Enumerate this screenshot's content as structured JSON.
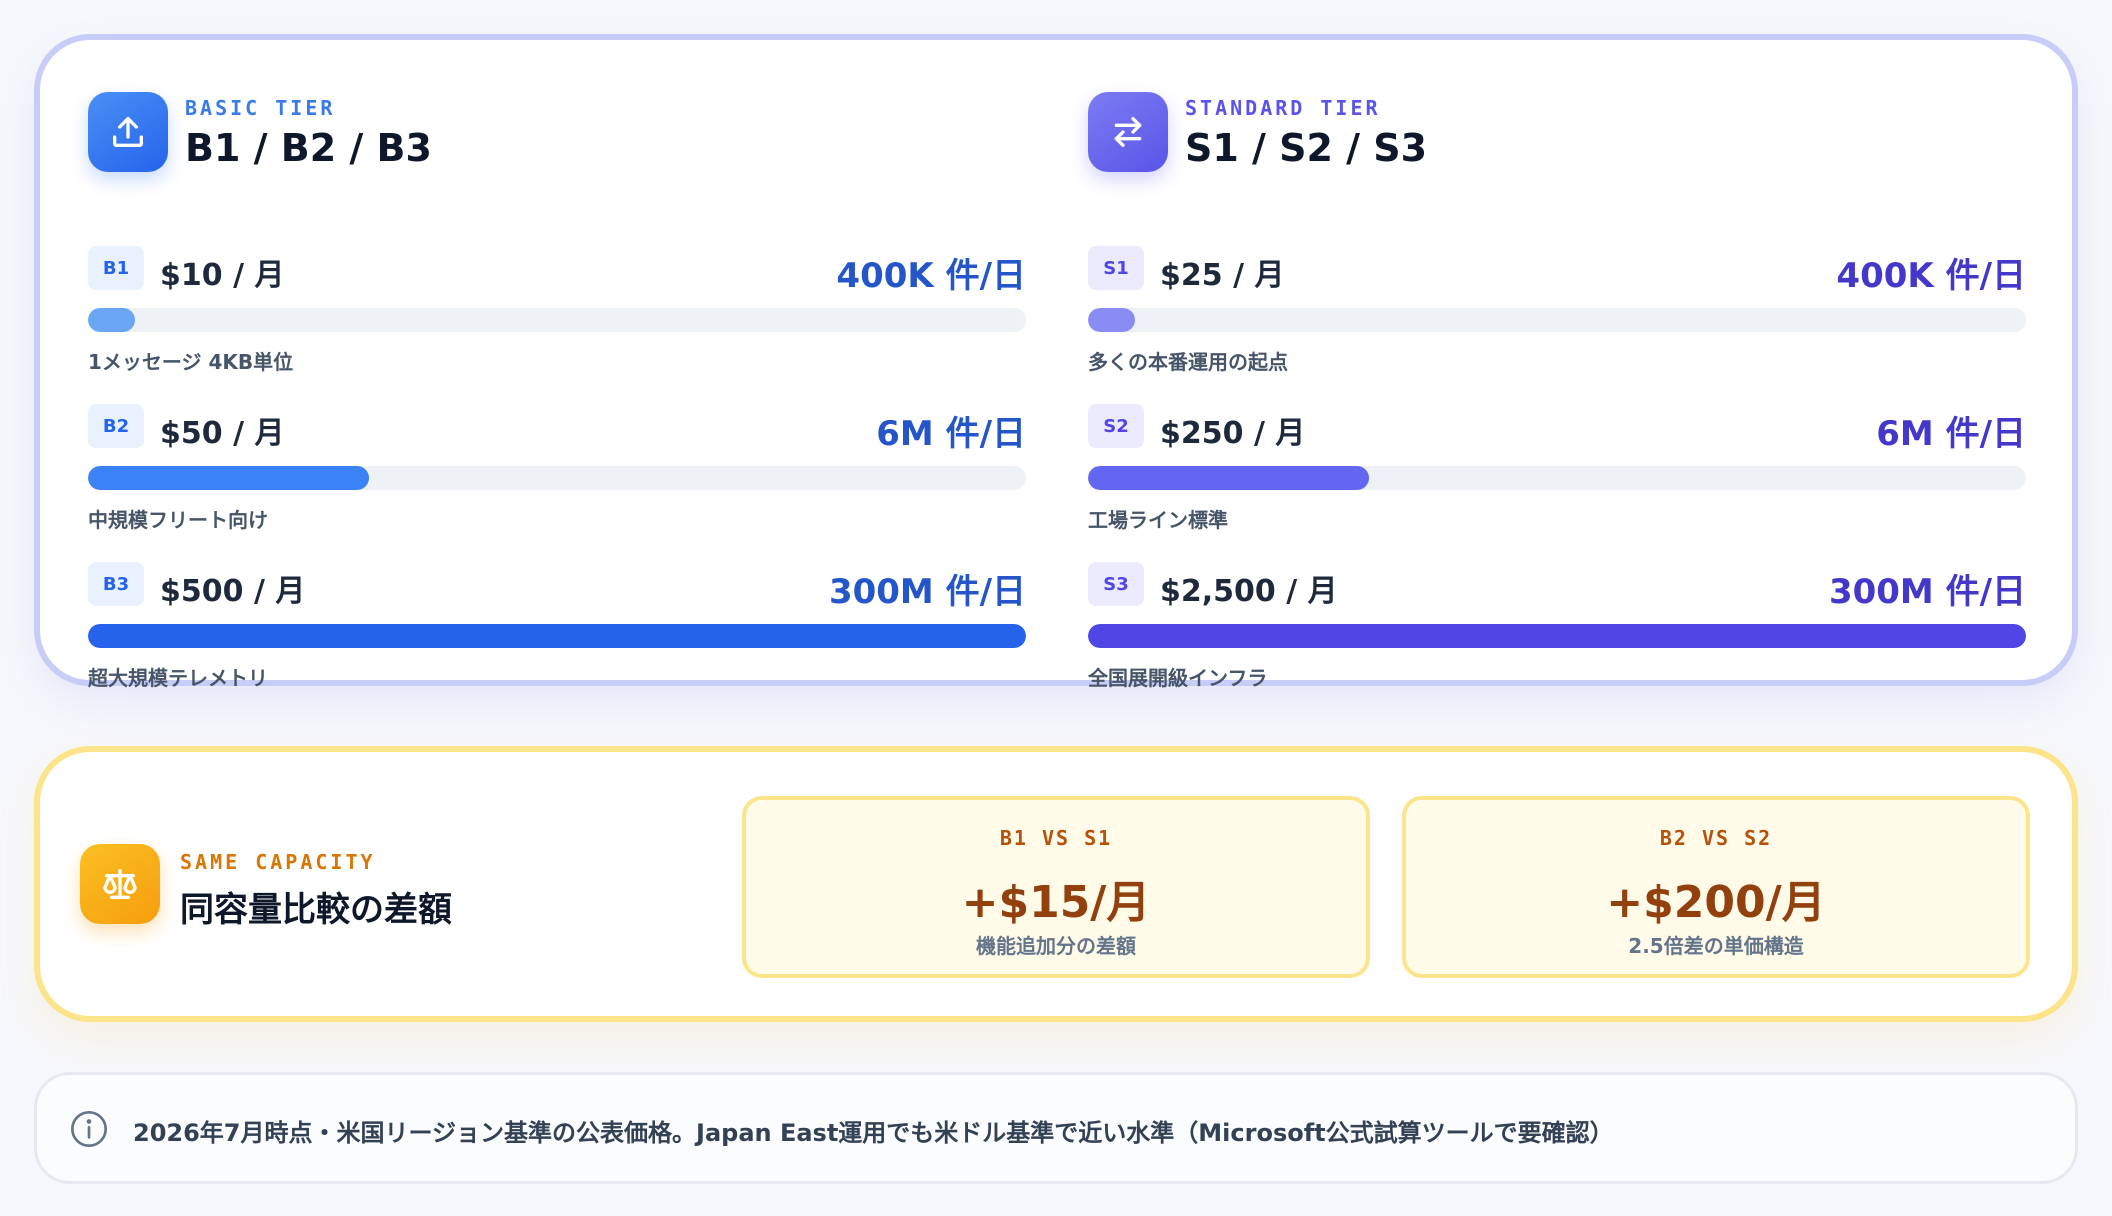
{
  "tiers": [
    {
      "kicker": "BASIC TIER",
      "title": "B1 / B2 / B3",
      "icon": "upload-icon",
      "color": "#2563eb",
      "plans": [
        {
          "code": "B1",
          "price": "$10 / 月",
          "capacity": "400K 件/日",
          "note": "1メッセージ 4KB単位",
          "level": 0.05
        },
        {
          "code": "B2",
          "price": "$50 / 月",
          "capacity": "6M 件/日",
          "note": "中規模フリート向け",
          "level": 0.3
        },
        {
          "code": "B3",
          "price": "$500 / 月",
          "capacity": "300M 件/日",
          "note": "超大規模テレメトリ",
          "level": 1.0
        }
      ]
    },
    {
      "kicker": "STANDARD TIER",
      "title": "S1 / S2 / S3",
      "icon": "swap-arrows-icon",
      "color": "#4f46e5",
      "plans": [
        {
          "code": "S1",
          "price": "$25 / 月",
          "capacity": "400K 件/日",
          "note": "多くの本番運用の起点",
          "level": 0.05
        },
        {
          "code": "S2",
          "price": "$250 / 月",
          "capacity": "6M 件/日",
          "note": "工場ライン標準",
          "level": 0.3
        },
        {
          "code": "S3",
          "price": "$2,500 / 月",
          "capacity": "300M 件/日",
          "note": "全国展開級インフラ",
          "level": 1.0
        }
      ]
    }
  ],
  "comparison": {
    "kicker": "SAME CAPACITY",
    "title": "同容量比較の差額",
    "icon": "scale-icon",
    "items": [
      {
        "label": "B1 VS S1",
        "value": "+$15/月",
        "desc": "機能追加分の差額"
      },
      {
        "label": "B2 VS S2",
        "value": "+$200/月",
        "desc": "2.5倍差の単価構造"
      }
    ]
  },
  "footnote": {
    "icon": "info-icon",
    "text": "2026年7月時点・米国リージョン基準の公表価格。Japan East運用でも米ドル基準で近い水準（Microsoft公式試算ツールで要確認）"
  }
}
